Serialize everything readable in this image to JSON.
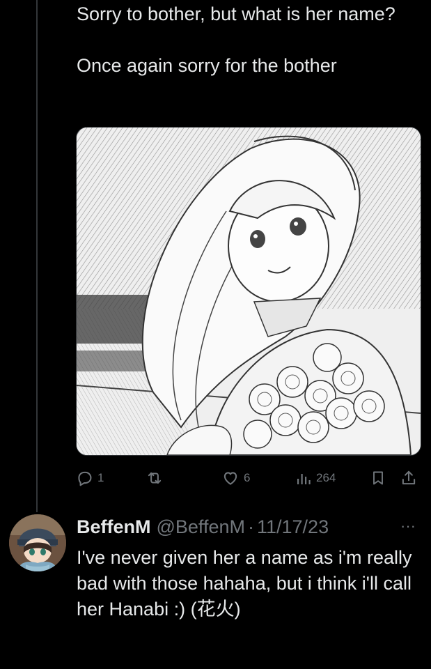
{
  "original_tweet": {
    "text": "Sorry to bother, but what is her name?\n\nOnce again sorry for the bother",
    "media_alt": "illustration-of-girl-holding-roses",
    "actions": {
      "reply_count": "1",
      "retweet_count": "",
      "like_count": "6",
      "views_count": "264"
    }
  },
  "reply": {
    "display_name": "BeffenM",
    "handle": "@BeffenM",
    "separator": "·",
    "date": "11/17/23",
    "more_label": "···",
    "text": "I've never given her a name as i'm really bad with those hahaha, but i think i'll call her Hanabi :) (花火)"
  },
  "colors": {
    "background": "#000000",
    "text_primary": "#e7e9ea",
    "text_secondary": "#71767b",
    "thread_line": "#333639"
  },
  "icons": [
    "reply-icon",
    "retweet-icon",
    "like-icon",
    "views-icon",
    "bookmark-icon",
    "share-icon",
    "more-icon"
  ]
}
